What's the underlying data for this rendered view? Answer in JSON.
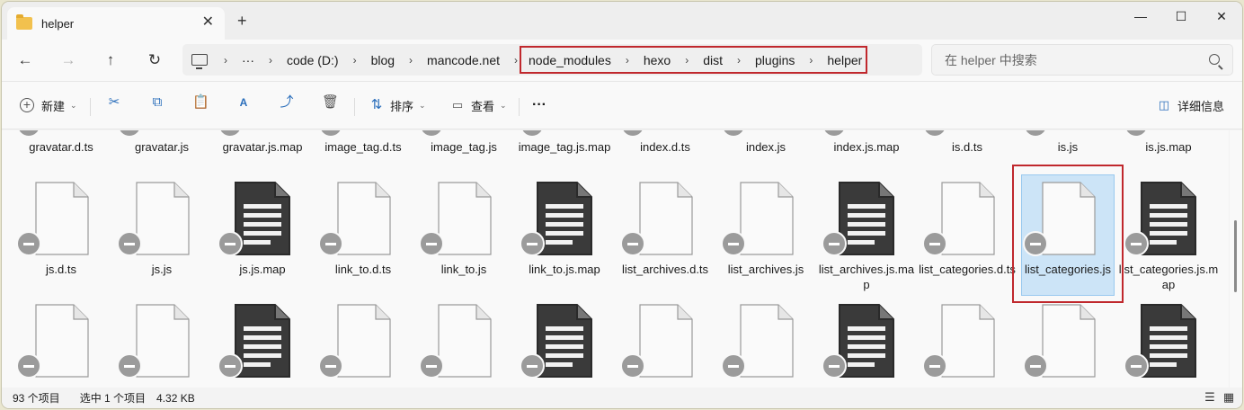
{
  "titlebar": {
    "tab_title": "helper",
    "close_glyph": "✕",
    "newtab_glyph": "+",
    "min_glyph": "—",
    "max_glyph": "☐",
    "closewin_glyph": "✕"
  },
  "nav": {
    "back": "←",
    "forward": "→",
    "up": "↑",
    "refresh": "↻",
    "ellipsis": "···",
    "crumbs": [
      "code (D:)",
      "blog",
      "mancode.net"
    ],
    "highlighted_crumbs": [
      "node_modules",
      "hexo",
      "dist",
      "plugins",
      "helper"
    ],
    "search_placeholder": "在 helper 中搜索"
  },
  "toolbar": {
    "new_label": "新建",
    "sort_label": "排序",
    "view_label": "查看",
    "more": "···",
    "details_label": "详细信息"
  },
  "files": {
    "row1": [
      "gravatar.d.ts",
      "gravatar.js",
      "gravatar.js.map",
      "image_tag.d.ts",
      "image_tag.js",
      "image_tag.js.map",
      "index.d.ts",
      "index.js",
      "index.js.map",
      "is.d.ts",
      "is.js",
      "is.js.map"
    ],
    "row2": [
      "js.d.ts",
      "js.js",
      "js.js.map",
      "link_to.d.ts",
      "link_to.js",
      "link_to.js.map",
      "list_archives.d.ts",
      "list_archives.js",
      "list_archives.js.map",
      "list_categories.d.ts",
      "list_categories.js",
      "list_categories.js.map"
    ],
    "row2_types": [
      "blank",
      "blank",
      "map",
      "blank",
      "blank",
      "map",
      "blank",
      "blank",
      "map",
      "blank",
      "blank",
      "map"
    ],
    "row3_types": [
      "blank",
      "blank",
      "map",
      "blank",
      "blank",
      "map",
      "blank",
      "blank",
      "map",
      "blank",
      "blank",
      "map"
    ],
    "selected": "list_categories.js"
  },
  "status": {
    "count": "93 个项目",
    "selected": "选中 1 个项目",
    "size": "4.32 KB"
  }
}
